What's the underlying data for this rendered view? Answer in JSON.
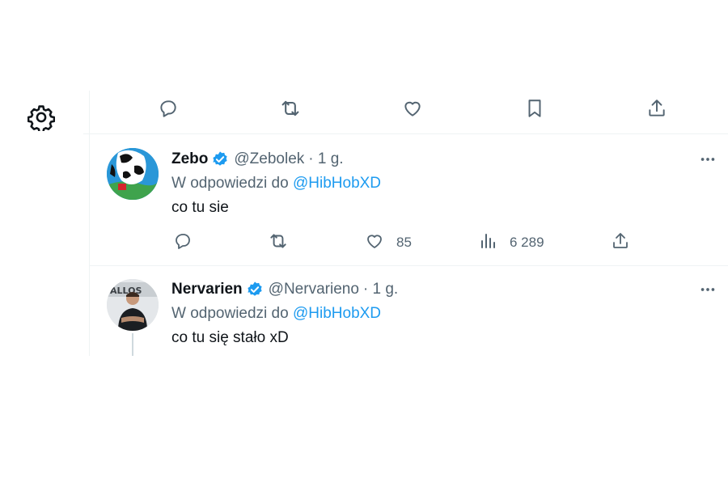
{
  "colors": {
    "accent": "#1d9bf0",
    "text": "#0f1419",
    "muted": "#536471",
    "verified": "#1d9bf0"
  },
  "top_actions": [
    "reply-icon",
    "retweet-icon",
    "like-icon",
    "bookmark-icon",
    "share-icon"
  ],
  "settings_icon": "gear-icon",
  "tweets": [
    {
      "name": "Zebo",
      "handle": "@Zebolek",
      "time": "· 1 g.",
      "reply_prefix": "W odpowiedzi do",
      "reply_mention": "@HibHobXD",
      "text": "co tu sie",
      "likes": "85",
      "views": "6 289"
    },
    {
      "name": "Nervarien",
      "handle": "@Nervarieno",
      "time": "· 1 g.",
      "reply_prefix": "W odpowiedzi do",
      "reply_mention": "@HibHobXD",
      "text": "co tu się stało xD"
    }
  ]
}
